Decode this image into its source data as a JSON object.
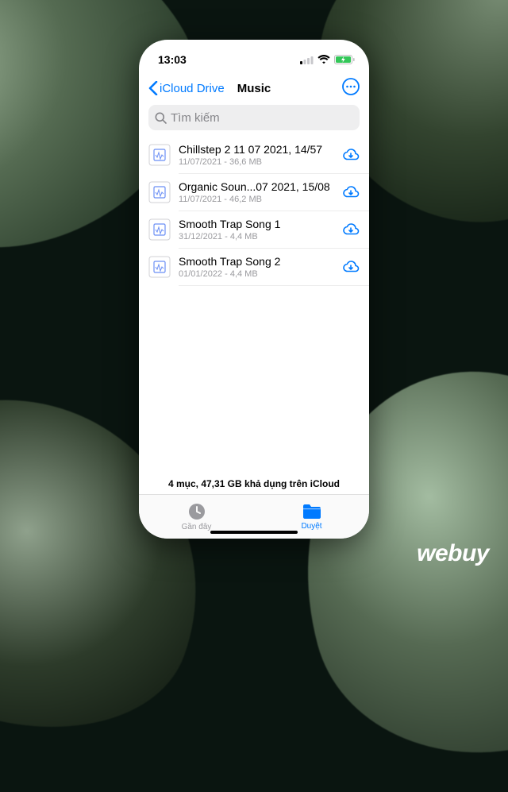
{
  "status": {
    "time": "13:03"
  },
  "nav": {
    "back": "iCloud Drive",
    "title": "Music"
  },
  "search": {
    "placeholder": "Tìm kiếm"
  },
  "files": [
    {
      "name": "Chillstep 2 11 07 2021, 14/57",
      "meta": "11/07/2021 - 36,6 MB"
    },
    {
      "name": "Organic Soun...07 2021, 15/08",
      "meta": "11/07/2021 - 46,2 MB"
    },
    {
      "name": "Smooth Trap Song 1",
      "meta": "31/12/2021 - 4,4 MB"
    },
    {
      "name": "Smooth Trap Song 2",
      "meta": "01/01/2022 - 4,4 MB"
    }
  ],
  "summary": "4 mục, 47,31 GB khả dụng trên iCloud",
  "tabs": {
    "recents": "Gần đây",
    "browse": "Duyệt"
  },
  "watermark": "webuy"
}
